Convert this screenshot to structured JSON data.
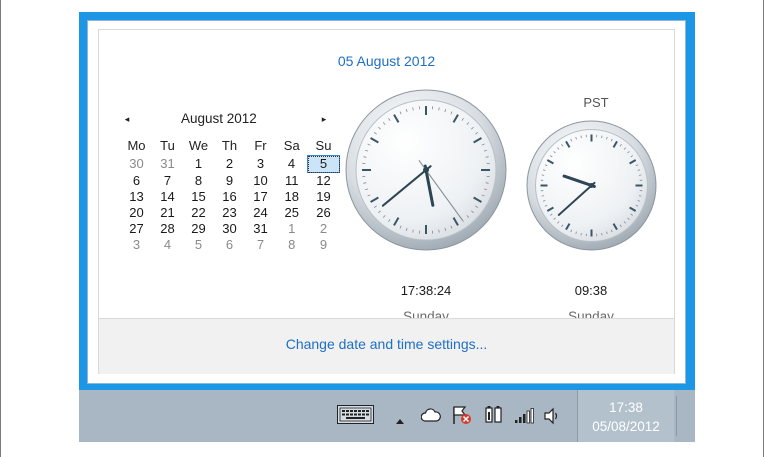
{
  "header": {
    "date": "05 August 2012"
  },
  "calendar": {
    "month": "August 2012",
    "prev_icon": "◂",
    "next_icon": "▸",
    "weekdays": [
      "Mo",
      "Tu",
      "We",
      "Th",
      "Fr",
      "Sa",
      "Su"
    ],
    "weeks": [
      [
        {
          "d": "30",
          "o": true
        },
        {
          "d": "31",
          "o": true
        },
        {
          "d": "1"
        },
        {
          "d": "2"
        },
        {
          "d": "3"
        },
        {
          "d": "4"
        },
        {
          "d": "5",
          "today": true
        }
      ],
      [
        {
          "d": "6"
        },
        {
          "d": "7"
        },
        {
          "d": "8"
        },
        {
          "d": "9"
        },
        {
          "d": "10"
        },
        {
          "d": "11"
        },
        {
          "d": "12"
        }
      ],
      [
        {
          "d": "13"
        },
        {
          "d": "14"
        },
        {
          "d": "15"
        },
        {
          "d": "16"
        },
        {
          "d": "17"
        },
        {
          "d": "18"
        },
        {
          "d": "19"
        }
      ],
      [
        {
          "d": "20"
        },
        {
          "d": "21"
        },
        {
          "d": "22"
        },
        {
          "d": "23"
        },
        {
          "d": "24"
        },
        {
          "d": "25"
        },
        {
          "d": "26"
        }
      ],
      [
        {
          "d": "27"
        },
        {
          "d": "28"
        },
        {
          "d": "29"
        },
        {
          "d": "30"
        },
        {
          "d": "31"
        },
        {
          "d": "1",
          "o": true
        },
        {
          "d": "2",
          "o": true
        }
      ],
      [
        {
          "d": "3",
          "o": true
        },
        {
          "d": "4",
          "o": true
        },
        {
          "d": "5",
          "o": true
        },
        {
          "d": "6",
          "o": true
        },
        {
          "d": "7",
          "o": true
        },
        {
          "d": "8",
          "o": true
        },
        {
          "d": "9",
          "o": true
        }
      ]
    ]
  },
  "clocks": {
    "local": {
      "time": "17:38:24",
      "day": "Sunday",
      "h": 17,
      "m": 38,
      "s": 24
    },
    "second": {
      "label": "PST",
      "time": "09:38",
      "day": "Sunday",
      "h": 9,
      "m": 38
    }
  },
  "footer": {
    "link": "Change date and time settings..."
  },
  "taskbar": {
    "time": "17:38",
    "date": "05/08/2012",
    "icons": [
      "keyboard-icon",
      "show-hidden-icons-icon",
      "cloud-icon",
      "action-center-flag-icon",
      "power-icon",
      "network-signal-icon",
      "volume-icon"
    ]
  },
  "colors": {
    "accent": "#1e96e6",
    "link": "#1e6fc5",
    "taskbar": "#a9b7c4"
  }
}
